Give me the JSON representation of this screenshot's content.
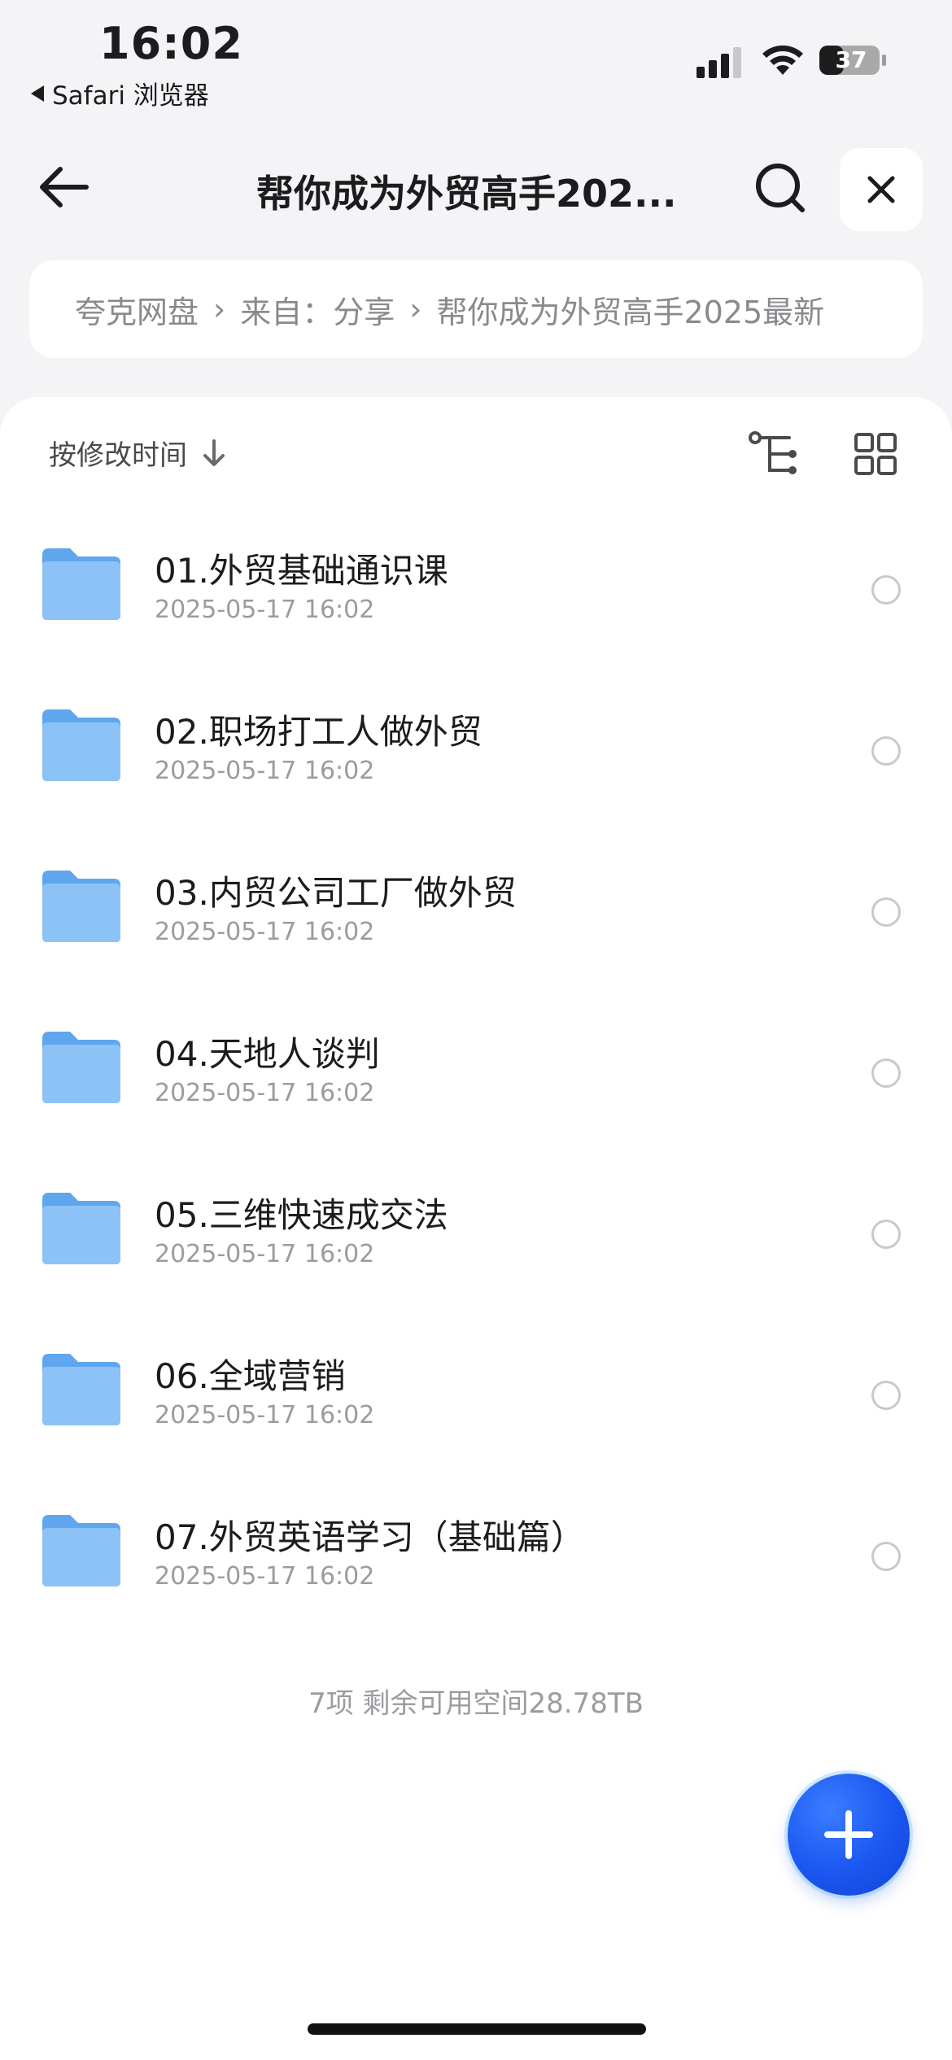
{
  "status_bar": {
    "time": "16:02",
    "back_app": "Safari 浏览器",
    "battery": "37"
  },
  "nav": {
    "title": "帮你成为外贸高手202...",
    "back_icon": "arrow-left-icon",
    "search_icon": "search-icon",
    "close_icon": "close-icon"
  },
  "breadcrumb": {
    "items": [
      "夸克网盘",
      "来自：分享",
      "帮你成为外贸高手2025最新"
    ]
  },
  "toolbar": {
    "sort_label": "按修改时间",
    "sort_icon": "arrow-down-icon",
    "tree_icon": "tree-structure-icon",
    "grid_icon": "grid-view-icon"
  },
  "files": [
    {
      "name": "01.外贸基础通识课",
      "date": "2025-05-17 16:02"
    },
    {
      "name": "02.职场打工人做外贸",
      "date": "2025-05-17 16:02"
    },
    {
      "name": "03.内贸公司工厂做外贸",
      "date": "2025-05-17 16:02"
    },
    {
      "name": "04.天地人谈判",
      "date": "2025-05-17 16:02"
    },
    {
      "name": "05.三维快速成交法",
      "date": "2025-05-17 16:02"
    },
    {
      "name": "06.全域营销",
      "date": "2025-05-17 16:02"
    },
    {
      "name": "07.外贸英语学习（基础篇）",
      "date": "2025-05-17 16:02"
    }
  ],
  "footer": {
    "info": "7项 剩余可用空间28.78TB"
  },
  "colors": {
    "accent": "#1a56f0",
    "folder": "#7cb9f4",
    "background": "#f4f4f6"
  }
}
